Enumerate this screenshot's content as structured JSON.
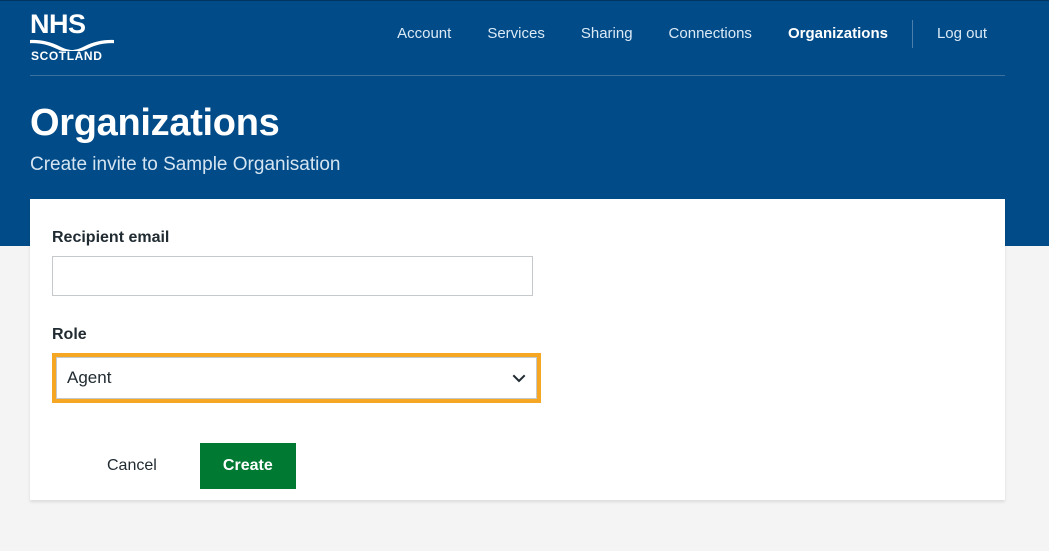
{
  "theme": {
    "brand_blue": "#004b88",
    "page_background": "#f4f4f4",
    "card_background": "#ffffff",
    "focus_amber": "#f5a623",
    "action_green": "#007a33",
    "input_border": "#c5c9cc"
  },
  "header": {
    "logo": {
      "primary": "NHS",
      "secondary": "SCOTLAND",
      "icon": "nhs-scotland-logo"
    },
    "nav": [
      {
        "label": "Account",
        "active": false
      },
      {
        "label": "Services",
        "active": false
      },
      {
        "label": "Sharing",
        "active": false
      },
      {
        "label": "Connections",
        "active": false
      },
      {
        "label": "Organizations",
        "active": true
      }
    ],
    "logout_label": "Log out"
  },
  "title_block": {
    "title": "Organizations",
    "subtitle": "Create invite to Sample Organisation"
  },
  "form": {
    "email_field": {
      "label": "Recipient email",
      "value": "",
      "placeholder": ""
    },
    "role_field": {
      "label": "Role",
      "selected": "Agent",
      "options": [
        "Agent"
      ],
      "chevron_icon": "chevron-down-icon",
      "focused": true
    },
    "actions": {
      "cancel_label": "Cancel",
      "create_label": "Create"
    }
  }
}
